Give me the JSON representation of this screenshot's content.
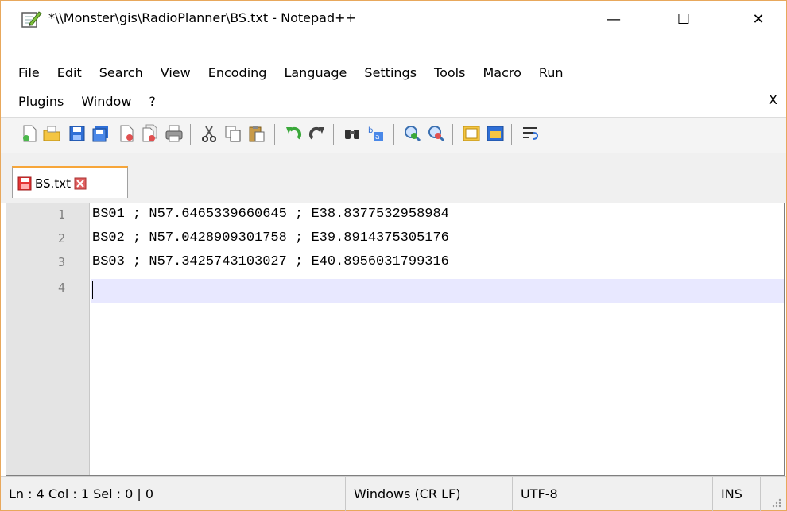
{
  "window": {
    "title": "*\\\\Monster\\gis\\RadioPlanner\\BS.txt - Notepad++",
    "minimize_label": "—",
    "maximize_label": "☐",
    "close_label": "✕"
  },
  "menu": {
    "row1": [
      "File",
      "Edit",
      "Search",
      "View",
      "Encoding",
      "Language",
      "Settings",
      "Tools",
      "Macro",
      "Run"
    ],
    "row2": [
      "Plugins",
      "Window",
      "?"
    ],
    "close_doc_label": "X"
  },
  "toolbar": {
    "icons": [
      "new-file-icon",
      "open-file-icon",
      "save-icon",
      "save-all-icon",
      "close-icon",
      "close-all-icon",
      "print-icon",
      "cut-icon",
      "copy-icon",
      "paste-icon",
      "undo-icon",
      "redo-icon",
      "find-icon",
      "replace-icon",
      "zoom-in-icon",
      "zoom-out-icon",
      "sync-vertical-icon",
      "sync-horizontal-icon",
      "word-wrap-icon"
    ]
  },
  "tabs": [
    {
      "label": "BS.txt",
      "modified": true
    }
  ],
  "editor": {
    "line_numbers": [
      "1",
      "2",
      "3",
      "4"
    ],
    "lines": [
      "BS01 ; N57.6465339660645 ; E38.8377532958984",
      "BS02 ; N57.0428909301758 ; E39.8914375305176",
      "BS03 ; N57.3425743103027 ; E40.8956031799316",
      ""
    ]
  },
  "status": {
    "position": "Ln : 4    Col : 1    Sel : 0 | 0",
    "eol": "Windows (CR LF)",
    "encoding": "UTF-8",
    "mode": "INS"
  },
  "colors": {
    "accent": "#f7a63a",
    "current_line": "#e8e8ff",
    "gutter": "#e4e4e4"
  }
}
